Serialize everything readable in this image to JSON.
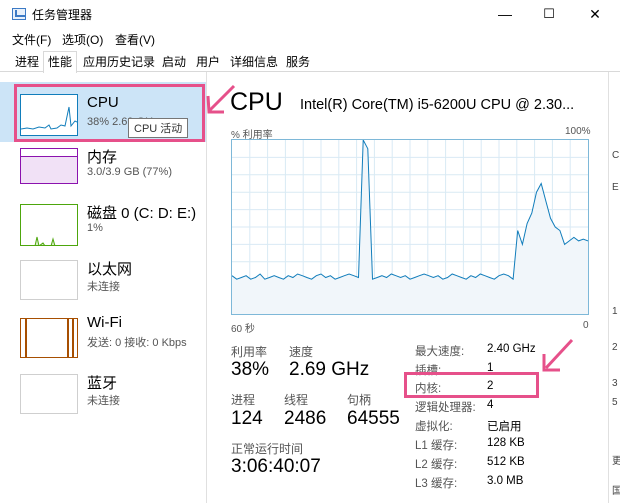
{
  "window": {
    "title": "任务管理器",
    "minimize": "—",
    "maximize": "☐",
    "close": "✕"
  },
  "menu": [
    "文件(F)",
    "选项(O)",
    "查看(V)"
  ],
  "tabs": [
    "进程",
    "性能",
    "应用历史记录",
    "启动",
    "用户",
    "详细信息",
    "服务"
  ],
  "active_tab": "性能",
  "sidebar": {
    "cpu": {
      "name": "CPU",
      "sub": "38% 2.69 GHz",
      "tooltip": "CPU 活动"
    },
    "memory": {
      "name": "内存",
      "sub": "3.0/3.9 GB (77%)"
    },
    "disk": {
      "name": "磁盘 0 (C: D: E:)",
      "sub": "1%"
    },
    "ethernet": {
      "name": "以太网",
      "sub": "未连接"
    },
    "wifi": {
      "name": "Wi-Fi",
      "sub": "发送: 0 接收: 0 Kbps"
    },
    "bluetooth": {
      "name": "蓝牙",
      "sub": "未连接"
    }
  },
  "main": {
    "title": "CPU",
    "model": "Intel(R) Core(TM) i5-6200U CPU @ 2.30...",
    "util_label": "% 利用率",
    "util_max": "100%",
    "x_left": "60 秒",
    "x_right": "0",
    "stats": {
      "utilization_label": "利用率",
      "utilization": "38%",
      "speed_label": "速度",
      "speed": "2.69 GHz",
      "processes_label": "进程",
      "processes": "124",
      "threads_label": "线程",
      "threads": "2486",
      "handles_label": "句柄",
      "handles": "64555",
      "uptime_label": "正常运行时间",
      "uptime": "3:06:40:07"
    },
    "details": [
      {
        "label": "最大速度:",
        "value": "2.40 GHz"
      },
      {
        "label": "插槽:",
        "value": "1"
      },
      {
        "label": "内核:",
        "value": "2"
      },
      {
        "label": "逻辑处理器:",
        "value": "4"
      },
      {
        "label": "虚拟化:",
        "value": "已启用"
      },
      {
        "label": "L1 缓存:",
        "value": "128 KB"
      },
      {
        "label": "L2 缓存:",
        "value": "512 KB"
      },
      {
        "label": "L3 缓存:",
        "value": "3.0 MB"
      }
    ]
  },
  "cpu_history": [
    22,
    20,
    21,
    22,
    20,
    21,
    23,
    20,
    21,
    22,
    21,
    20,
    22,
    21,
    23,
    22,
    21,
    20,
    22,
    23,
    21,
    22,
    20,
    21,
    22,
    23,
    22,
    21,
    100,
    95,
    20,
    21,
    22,
    21,
    23,
    22,
    21,
    22,
    20,
    21,
    22,
    23,
    22,
    21,
    22,
    20,
    21,
    23,
    22,
    21,
    20,
    22,
    21,
    23,
    22,
    21,
    20,
    22,
    23,
    22,
    20,
    48,
    40,
    52,
    58,
    70,
    75,
    65,
    55,
    50,
    48,
    40,
    42,
    44,
    42,
    43,
    42
  ],
  "colors": {
    "accent": "#117dbb",
    "highlight": "#e6508a",
    "memory": "#8b12ae",
    "disk": "#4da60c",
    "wifi": "#a74f01"
  },
  "right_edge": [
    "C",
    "E",
    "1",
    "2",
    "3",
    "5",
    "更",
    "国"
  ]
}
